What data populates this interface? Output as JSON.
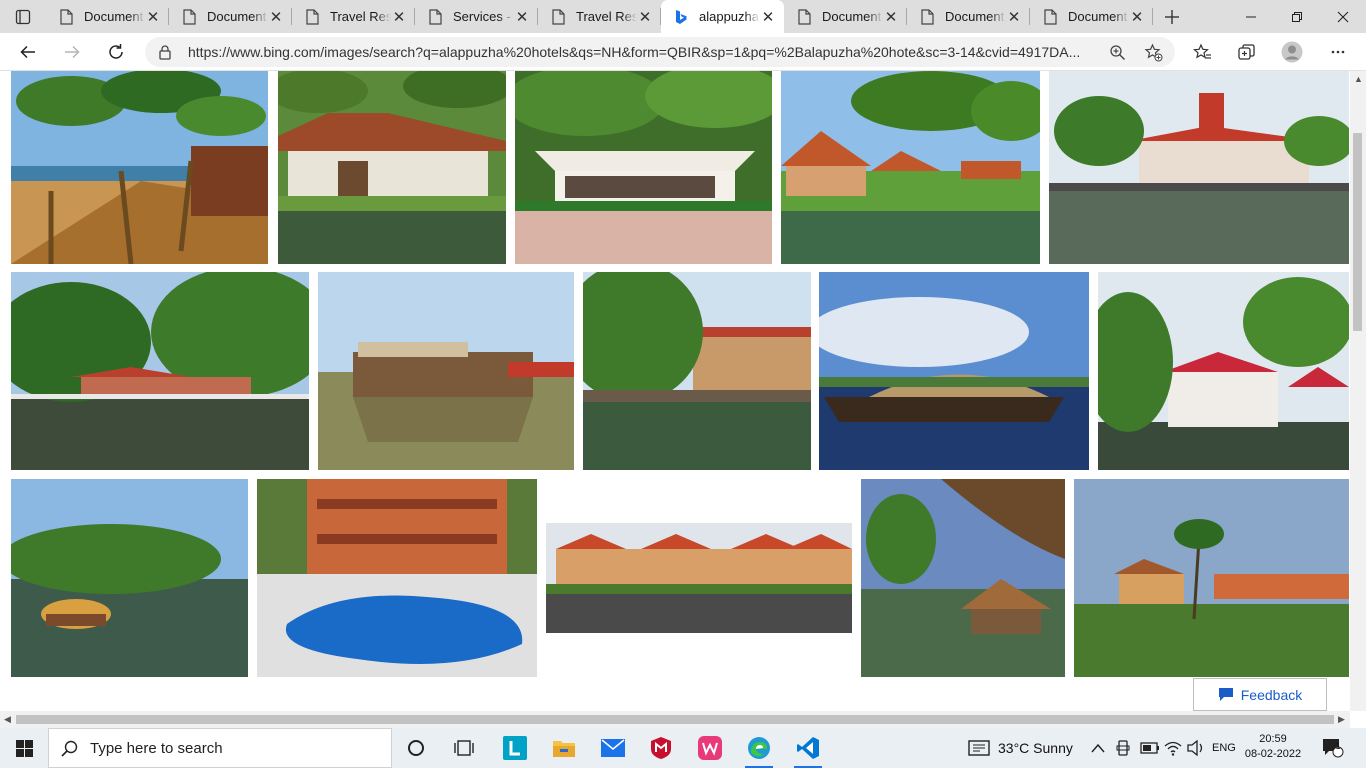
{
  "browser": {
    "tabs": [
      {
        "title": "Document",
        "icon": "doc-icon",
        "active": false
      },
      {
        "title": "Document",
        "icon": "doc-icon",
        "active": false
      },
      {
        "title": "Travel Resp",
        "icon": "doc-icon",
        "active": false
      },
      {
        "title": "Services - T",
        "icon": "doc-icon",
        "active": false
      },
      {
        "title": "Travel Resp",
        "icon": "doc-icon",
        "active": false
      },
      {
        "title": "alappuzha",
        "icon": "bing-icon",
        "active": true
      },
      {
        "title": "Document",
        "icon": "doc-icon",
        "active": false
      },
      {
        "title": "Document",
        "icon": "doc-icon",
        "active": false
      },
      {
        "title": "Document",
        "icon": "doc-icon",
        "active": false
      }
    ],
    "close_glyph": "✕",
    "address": {
      "url": "https://www.bing.com/images/search?q=alappuzha%20hotels&qs=NH&form=QBIR&sp=1&pq=%2Balapuzha%20hote&sc=3-14&cvid=4917DA..."
    }
  },
  "content": {
    "feedback_label": "Feedback"
  },
  "taskbar": {
    "search_placeholder": "Type here to search",
    "weather": "33°C  Sunny",
    "language": "ENG",
    "time": "20:59",
    "date": "08-02-2022",
    "notification_count": "1",
    "pinned": [
      {
        "name": "task-view-icon"
      },
      {
        "name": "widgets-icon"
      },
      {
        "name": "l-app-icon"
      },
      {
        "name": "file-explorer-icon"
      },
      {
        "name": "mail-icon"
      },
      {
        "name": "mcafee-icon"
      },
      {
        "name": "wps-office-icon"
      },
      {
        "name": "edge-icon"
      },
      {
        "name": "vscode-icon"
      }
    ]
  },
  "colors": {
    "accent": "#1a73e8",
    "bing_blue": "#1a5cc8",
    "tab_strip": "#dedede"
  }
}
